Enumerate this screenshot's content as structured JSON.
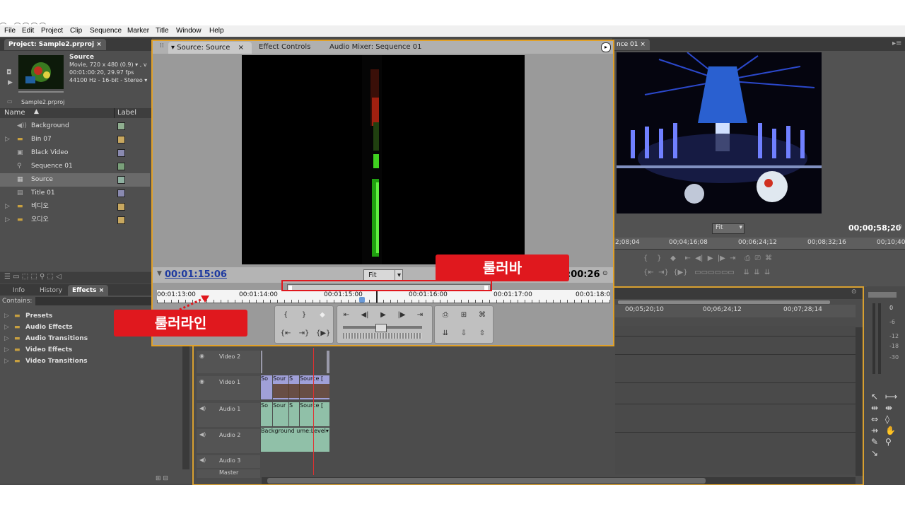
{
  "menu": [
    "File",
    "Edit",
    "Project",
    "Clip",
    "Sequence",
    "Marker",
    "Title",
    "Window",
    "Help"
  ],
  "project": {
    "tab": "Project: Sample2.prproj",
    "clip_name": "Source",
    "clip_info1": "Movie, 720 x 480 (0.9)  ▾ , v",
    "clip_info2": "00:01:00:20, 29.97 fps",
    "clip_info3": "44100 Hz - 16-bit - Stereo  ▾",
    "file": "Sample2.prproj",
    "col_name": "Name",
    "col_label": "Label",
    "items": [
      {
        "name": "Background",
        "color": "#8fae8f"
      },
      {
        "name": "Bin 07",
        "color": "#c8a860"
      },
      {
        "name": "Black Video",
        "color": "#8a8ab0"
      },
      {
        "name": "Sequence 01",
        "color": "#7aa07a"
      },
      {
        "name": "Source",
        "color": "#8fb0a0"
      },
      {
        "name": "Title 01",
        "color": "#8a8ab0"
      },
      {
        "name": "비디오",
        "color": "#c8a860"
      },
      {
        "name": "오디오",
        "color": "#c8a860"
      }
    ]
  },
  "effects": {
    "tabs": [
      "Info",
      "History",
      "Effects"
    ],
    "contains_label": "Contains:",
    "folders": [
      "Presets",
      "Audio Effects",
      "Audio Transitions",
      "Video Effects",
      "Video Transitions"
    ]
  },
  "source_monitor": {
    "tabs": [
      "Source: Source",
      "Effect Controls",
      "Audio Mixer: Sequence 01"
    ],
    "timecode": "00:01:15:06",
    "fit": "Fit",
    "duration_tail": ":00:26",
    "ruler": [
      "00:01:13:00",
      "00:01:14:00",
      "00:01:15:00",
      "00:01:16:00",
      "00:01:17:00",
      "00:01:18:0"
    ]
  },
  "program_monitor": {
    "tab_tail": "nce 01",
    "fit": "Fit",
    "timecode": "00;00;58;20",
    "ruler": [
      "2;08;04",
      "00;04;16;08",
      "00;06;24;12",
      "00;08;32;16",
      "00;10;40;"
    ]
  },
  "timeline": {
    "ruler": [
      "00;05;20;10",
      "00;06;24;12",
      "00;07;28;14"
    ],
    "tracks": [
      "Video 2",
      "Video 1",
      "Audio 1",
      "Audio 2",
      "Audio 3",
      "Master"
    ],
    "video1_clips": [
      "So",
      "Sour",
      "S",
      "Source ["
    ],
    "audio1_clips": [
      "So",
      "Sour",
      "S",
      "Source ["
    ],
    "audio2_clip": "Background ume:Level▾"
  },
  "meters": [
    "0",
    "-6",
    "-12",
    "-18",
    "-30"
  ],
  "callouts": {
    "bar": "룰러바",
    "line": "룰러라인"
  },
  "colors": {
    "accent": "#f0a020",
    "callout": "#e0181e",
    "timecode": "#1e3aa0"
  }
}
